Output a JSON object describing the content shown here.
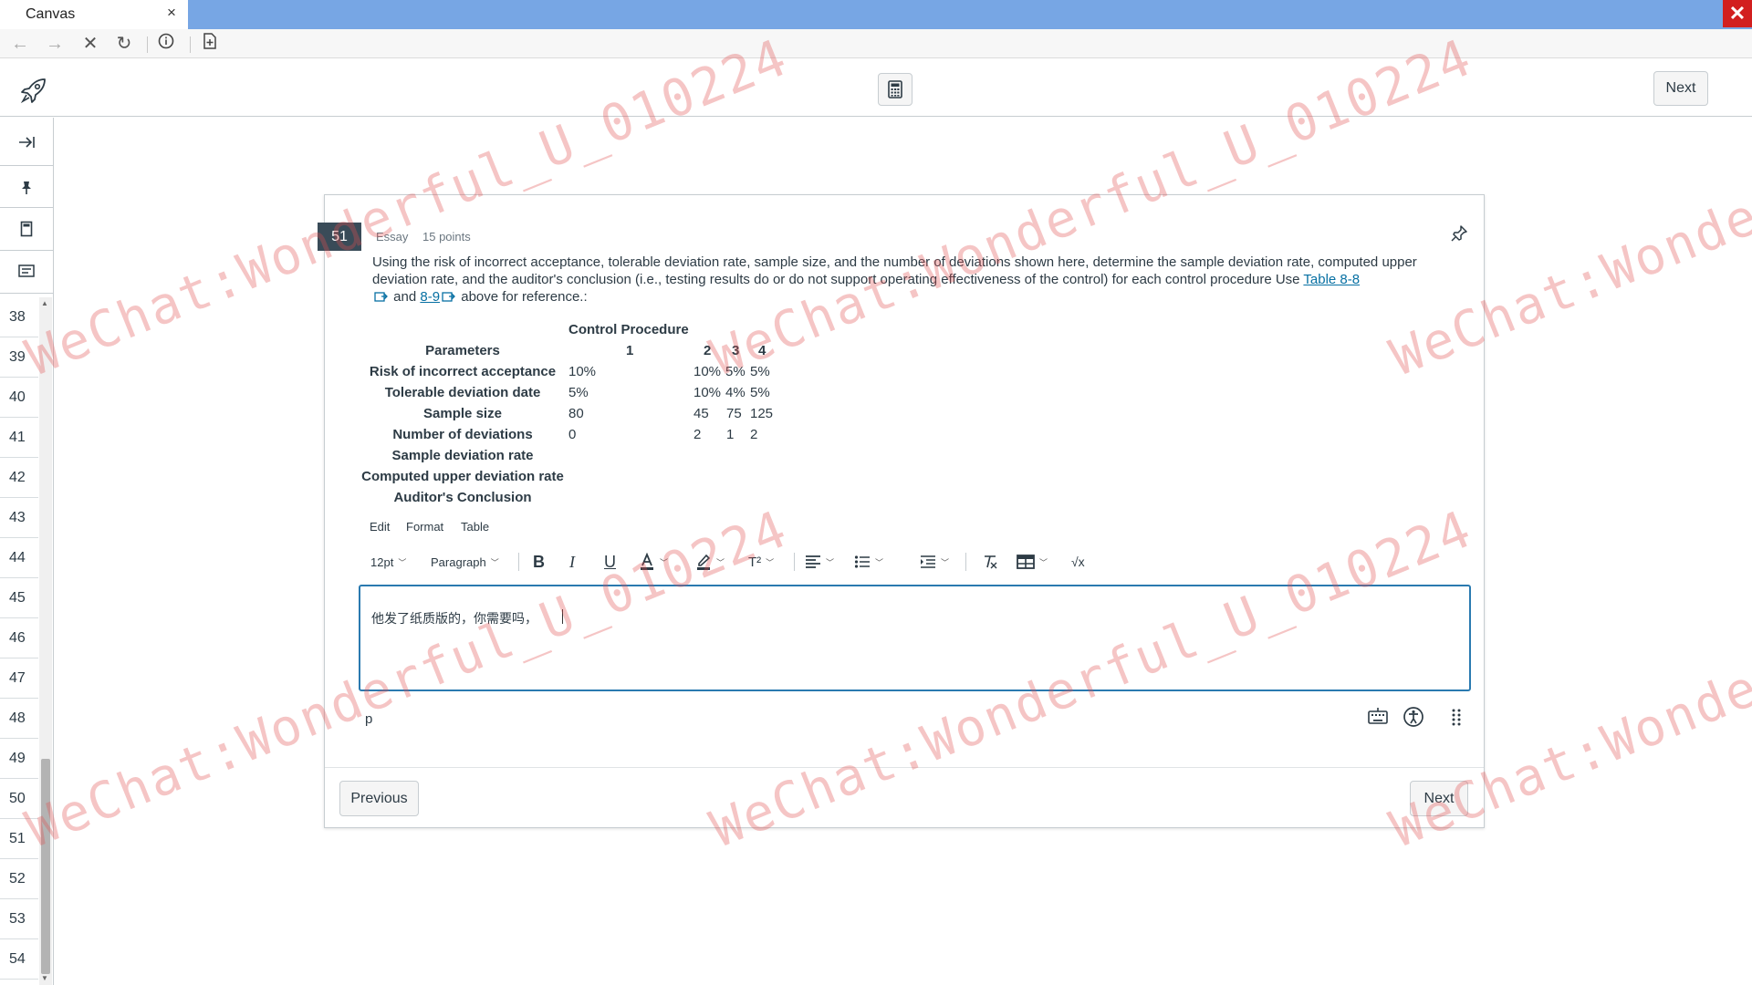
{
  "browser": {
    "tab_title": "Canvas",
    "tab_close": "×",
    "window_close": "✕"
  },
  "topbar": {
    "next_label": "Next"
  },
  "sidebar": {
    "question_numbers": [
      "38",
      "39",
      "40",
      "41",
      "42",
      "43",
      "44",
      "45",
      "46",
      "47",
      "48",
      "49",
      "50",
      "51",
      "52",
      "53",
      "54"
    ]
  },
  "question": {
    "number": "51",
    "type": "Essay",
    "points": "15 points",
    "text_part1": "Using the risk of incorrect acceptance, tolerable deviation rate, sample size, and the number of deviations shown here, determine the sample deviation rate, computed upper deviation rate, and the auditor's conclusion (i.e., testing results do or do not support operating effectiveness of the control) for each control procedure Use ",
    "link1": "Table 8-8",
    "text_and": " and ",
    "link2": "8-9",
    "text_part2": " above for reference.:",
    "table": {
      "group_header": "Control Procedure",
      "param_header": "Parameters",
      "columns": [
        "1",
        "2",
        "3",
        "4"
      ],
      "rows": [
        {
          "label": "Risk of incorrect acceptance",
          "values": [
            "10%",
            "10%",
            "5%",
            "5%"
          ]
        },
        {
          "label": "Tolerable deviation date",
          "values": [
            "5%",
            "10%",
            "4%",
            "5%"
          ]
        },
        {
          "label": "Sample size",
          "values": [
            "80",
            "45",
            "75",
            "125"
          ]
        },
        {
          "label": "Number of deviations",
          "values": [
            "0",
            "2",
            "1",
            "2"
          ]
        },
        {
          "label": "Sample deviation rate",
          "values": [
            "",
            "",
            "",
            ""
          ]
        },
        {
          "label": "Computed upper deviation rate",
          "values": [
            "",
            "",
            "",
            ""
          ]
        },
        {
          "label": "Auditor's Conclusion",
          "values": [
            "",
            "",
            "",
            ""
          ]
        }
      ]
    }
  },
  "editor": {
    "menu": {
      "edit": "Edit",
      "format": "Format",
      "table": "Table"
    },
    "font_size": "12pt",
    "block_format": "Paragraph",
    "superscript_label": "T²",
    "formula_label": "√x",
    "content": "他发了纸质版的，你需要吗，",
    "status_path": "p"
  },
  "nav": {
    "previous_label": "Previous",
    "next_label": "Next"
  },
  "watermark": {
    "text": "WeChat:Wonderful_U_010224"
  },
  "colors": {
    "titlebar": "#77a6e4",
    "badge": "#394b58",
    "link": "#0770a3",
    "editor_border": "#2a7ab0",
    "watermark": "#e15050",
    "close_button": "#d21f1f"
  }
}
